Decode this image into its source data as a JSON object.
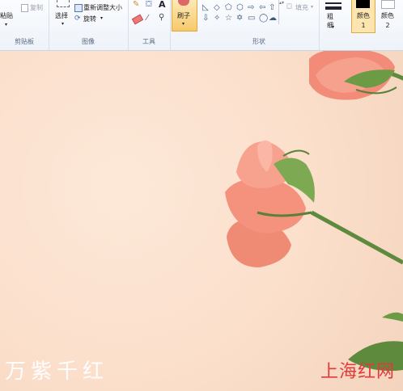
{
  "ribbon": {
    "clipboard": {
      "paste": "粘贴",
      "copy": "复制",
      "group": "剪贴板"
    },
    "image": {
      "select": "选择",
      "resize": "重新调整大小",
      "rotate": "旋转",
      "group": "图像"
    },
    "tools": {
      "group": "工具"
    },
    "brushes": {
      "label": "刷子"
    },
    "shapes": {
      "fill": "填充",
      "group": "形状"
    },
    "size": {
      "label": "粗细"
    },
    "colors": {
      "color1": "颜色 1",
      "color2": "颜色 2",
      "color1_value": "#000000",
      "color2_value": "#ffffff"
    }
  },
  "canvas": {
    "watermark_left": "万紫千红",
    "watermark_right": "上海红网"
  },
  "colors": {
    "background": "#fbe3cf",
    "ribbon": "#f3f6fb",
    "petal": "#f28b78",
    "stem": "#5e8a3e"
  }
}
